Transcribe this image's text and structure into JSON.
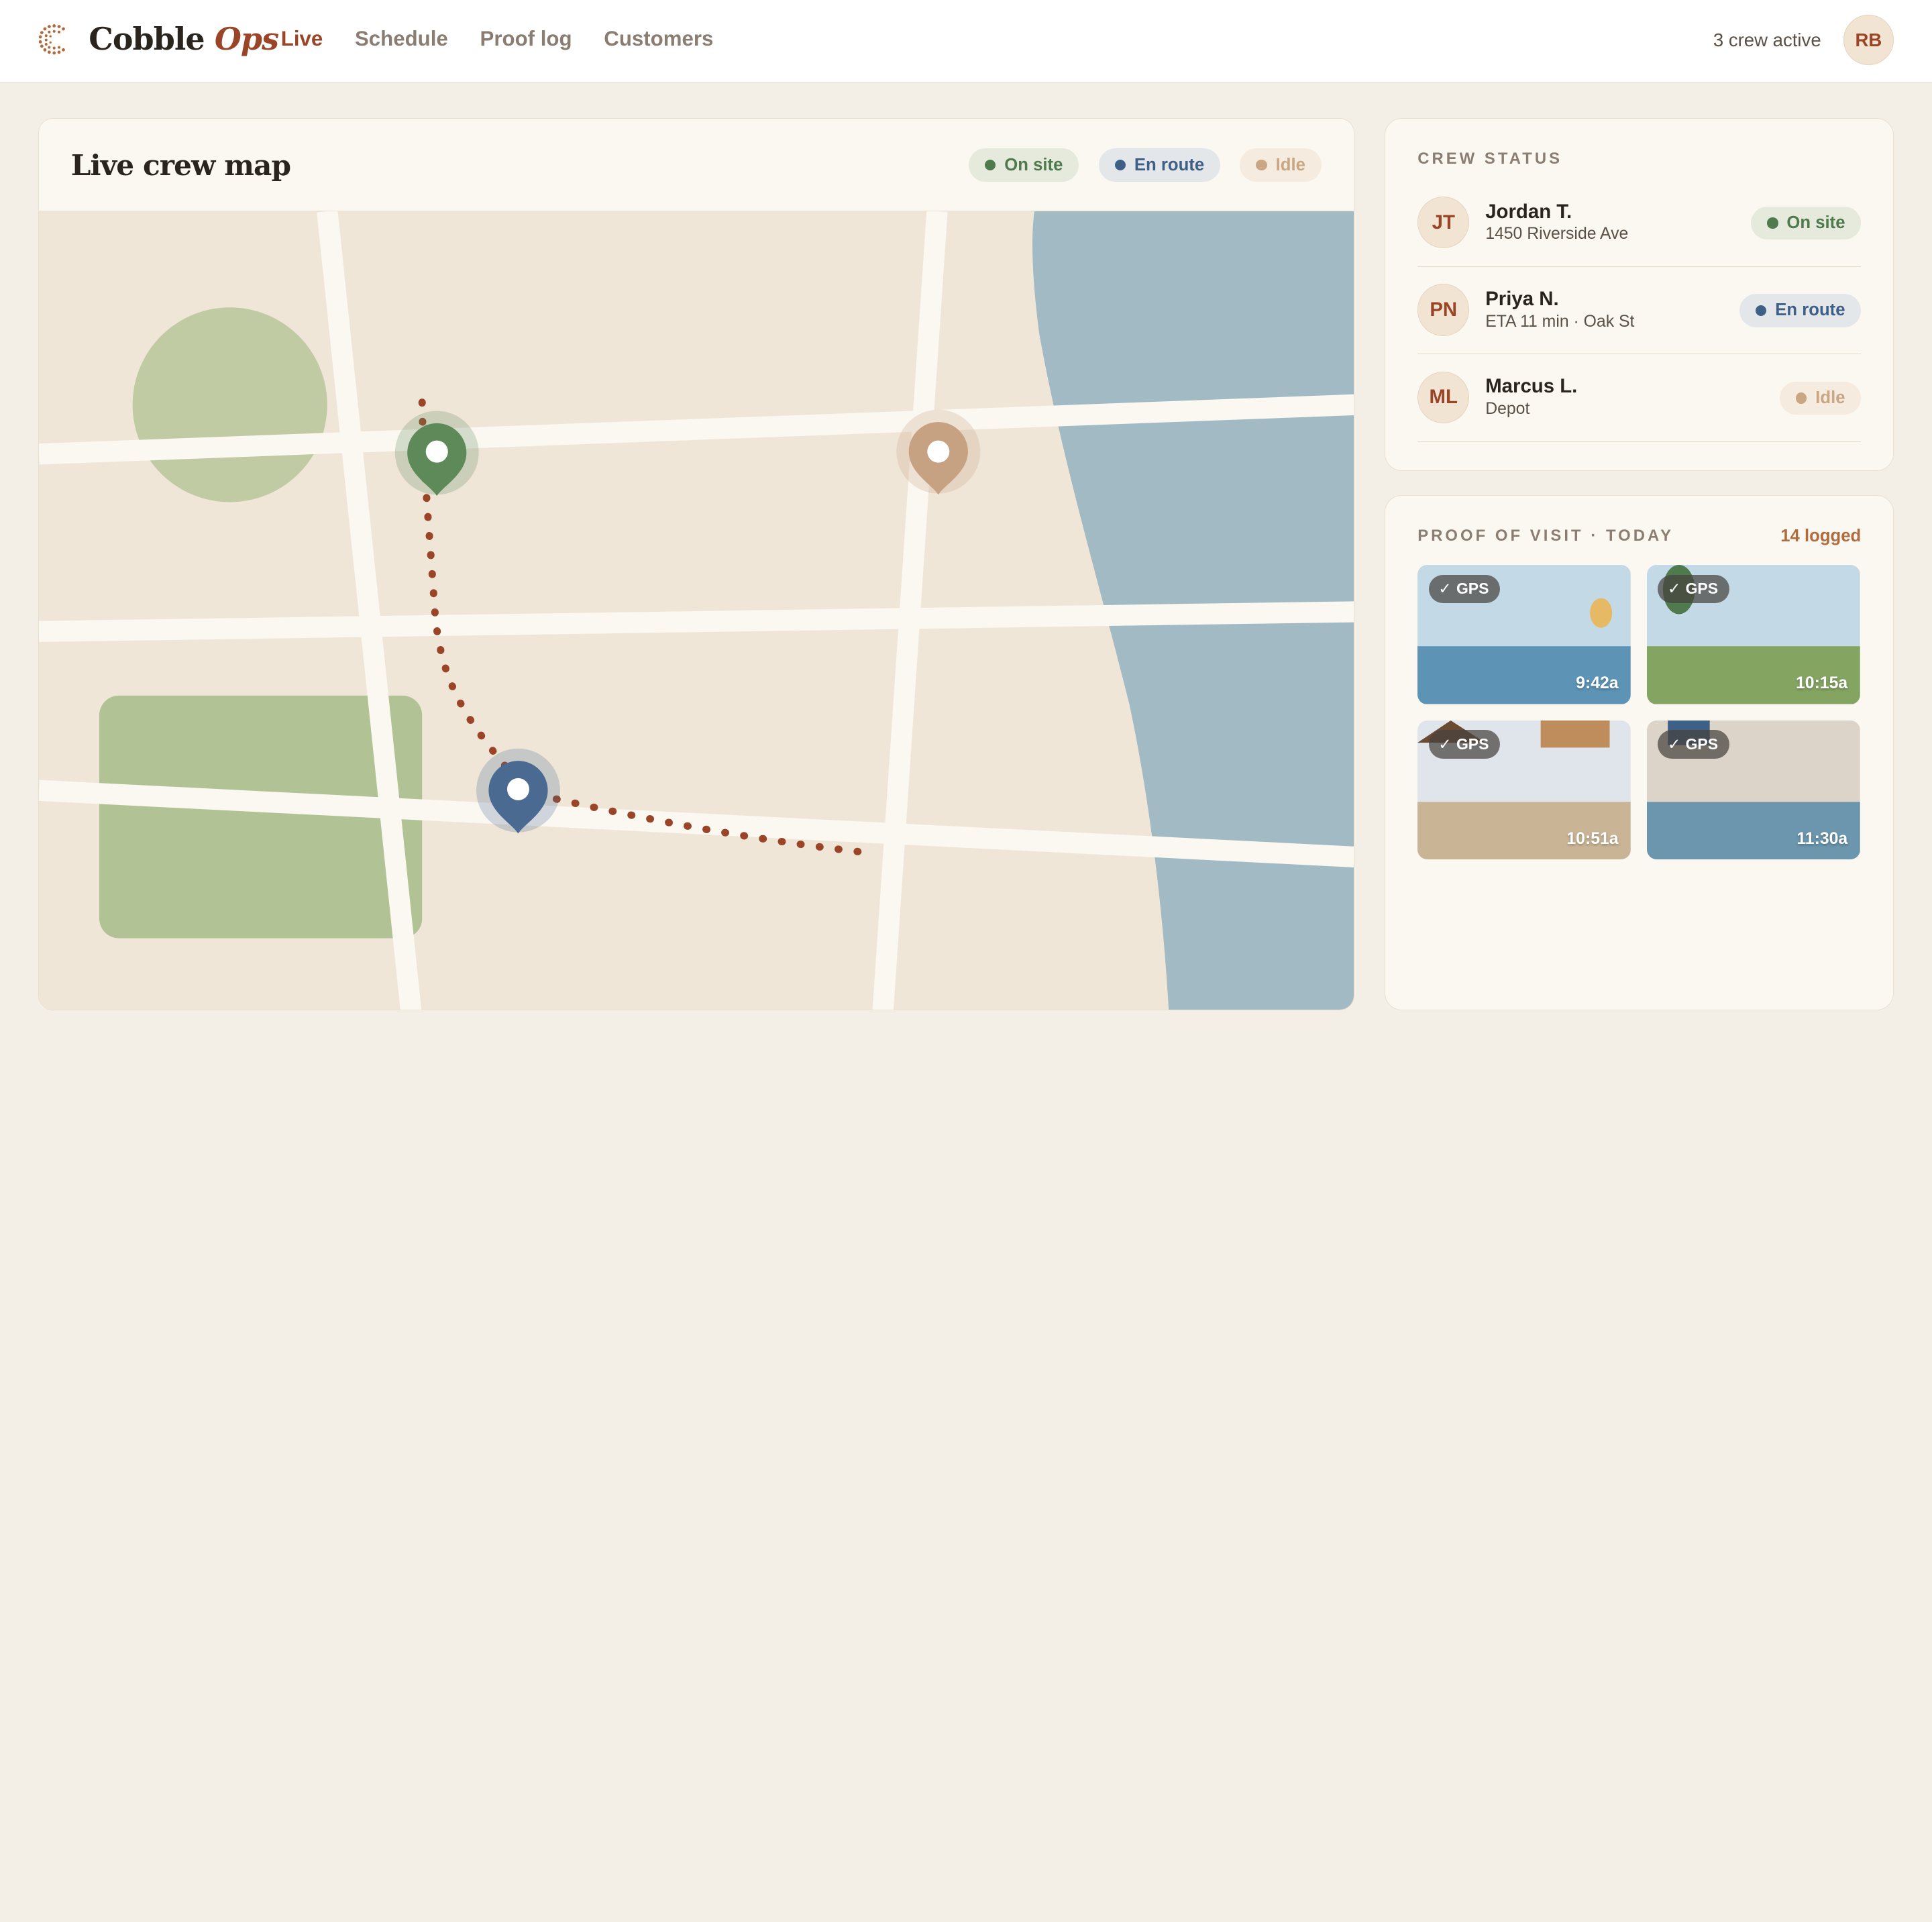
{
  "header": {
    "brand_main": "Cobble",
    "brand_accent": "Ops",
    "nav": [
      {
        "label": "Live",
        "active": true
      },
      {
        "label": "Schedule",
        "active": false
      },
      {
        "label": "Proof log",
        "active": false
      },
      {
        "label": "Customers",
        "active": false
      }
    ],
    "crew_active": "3 crew active",
    "user_initials": "RB"
  },
  "map": {
    "title": "Live crew map",
    "legend": [
      {
        "label": "On site",
        "color": "#4f7a4d"
      },
      {
        "label": "En route",
        "color": "#3e5f86"
      },
      {
        "label": "Idle",
        "color": "#c9a684"
      }
    ]
  },
  "crew_status": {
    "title": "CREW STATUS",
    "members": [
      {
        "initials": "JT",
        "name": "Jordan T.",
        "detail": "1450 Riverside Ave",
        "status": "On site"
      },
      {
        "initials": "PN",
        "name": "Priya N.",
        "detail": "ETA 11 min · Oak St",
        "status": "En route"
      },
      {
        "initials": "ML",
        "name": "Marcus L.",
        "detail": "Depot",
        "status": "Idle"
      }
    ]
  },
  "proof": {
    "title": "PROOF OF VISIT · TODAY",
    "logged": "14 logged",
    "badge": "GPS",
    "photos": [
      {
        "time": "9:42a"
      },
      {
        "time": "10:15a"
      },
      {
        "time": "10:51a"
      },
      {
        "time": "11:30a"
      }
    ]
  },
  "colors": {
    "accent": "#9a4527",
    "on_site": "#4f7a4d",
    "en_route": "#3e5f86",
    "idle": "#c9a684",
    "water": "#a2bac4",
    "park": "#b1c294"
  },
  "icons": [
    "cobble-logo-icon",
    "map-pin-icon",
    "check-icon"
  ]
}
